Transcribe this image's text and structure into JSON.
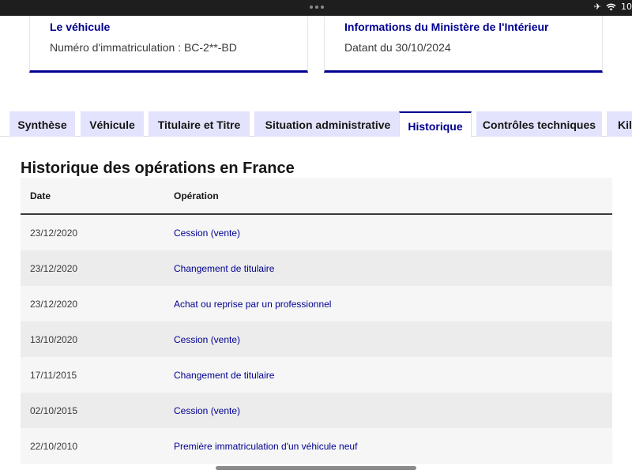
{
  "status_bar": {
    "airplane_icon": "airplane-icon",
    "wifi_icon": "wifi-icon",
    "time_partial": "10"
  },
  "cards": {
    "vehicle": {
      "title": "Le véhicule",
      "text": "Numéro d'immatriculation : BC-2**-BD"
    },
    "ministry": {
      "title": "Informations du Ministère de l'Intérieur",
      "text": "Datant du 30/10/2024"
    }
  },
  "tabs": [
    {
      "label": "Synthèse",
      "active": false
    },
    {
      "label": "Véhicule",
      "active": false
    },
    {
      "label": "Titulaire et Titre",
      "active": false
    },
    {
      "label": "Situation administrative",
      "active": false
    },
    {
      "label": "Historique",
      "active": true
    },
    {
      "label": "Contrôles techniques",
      "active": false
    },
    {
      "label": "Kilo",
      "active": false
    }
  ],
  "historique": {
    "title": "Historique des opérations en France",
    "columns": {
      "date": "Date",
      "operation": "Opération"
    },
    "rows": [
      {
        "date": "23/12/2020",
        "operation": "Cession (vente)"
      },
      {
        "date": "23/12/2020",
        "operation": "Changement de titulaire"
      },
      {
        "date": "23/12/2020",
        "operation": "Achat ou reprise par un professionnel"
      },
      {
        "date": "13/10/2020",
        "operation": "Cession (vente)"
      },
      {
        "date": "17/11/2015",
        "operation": "Changement de titulaire"
      },
      {
        "date": "02/10/2015",
        "operation": "Cession (vente)"
      },
      {
        "date": "22/10/2010",
        "operation": "Première immatriculation d'un véhicule neuf"
      }
    ]
  },
  "colors": {
    "accent": "#000091",
    "tab_bg": "#e3e3fd",
    "row_odd": "#f6f6f6",
    "row_even": "#ececec"
  }
}
